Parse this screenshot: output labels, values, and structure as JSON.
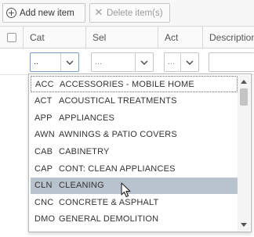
{
  "toolbar": {
    "add_label": "Add new item",
    "delete_label": "Delete item(s)",
    "add_icon": "plus-circle-icon",
    "delete_icon": "close-icon"
  },
  "grid": {
    "columns": [
      "Cat",
      "Sel",
      "Act",
      "Description"
    ]
  },
  "filters": {
    "cat_value": "..",
    "sel_value": "...",
    "act_value": "..."
  },
  "dropdown": {
    "focused_index": 0,
    "hover_index": 6,
    "items": [
      {
        "code": "ACC",
        "label": "ACCESSORIES - MOBILE HOME"
      },
      {
        "code": "ACT",
        "label": "ACOUSTICAL TREATMENTS"
      },
      {
        "code": "APP",
        "label": "APPLIANCES"
      },
      {
        "code": "AWN",
        "label": "AWNINGS & PATIO COVERS"
      },
      {
        "code": "CAB",
        "label": "CABINETRY"
      },
      {
        "code": "CAP",
        "label": "CONT: CLEAN APPLIANCES"
      },
      {
        "code": "CLN",
        "label": "CLEANING"
      },
      {
        "code": "CNC",
        "label": "CONCRETE & ASPHALT"
      },
      {
        "code": "DMO",
        "label": "GENERAL DEMOLITION"
      }
    ]
  },
  "colors": {
    "hover_bg": "#b9c3cd",
    "toolbar_bg": "#f7f7f7"
  }
}
